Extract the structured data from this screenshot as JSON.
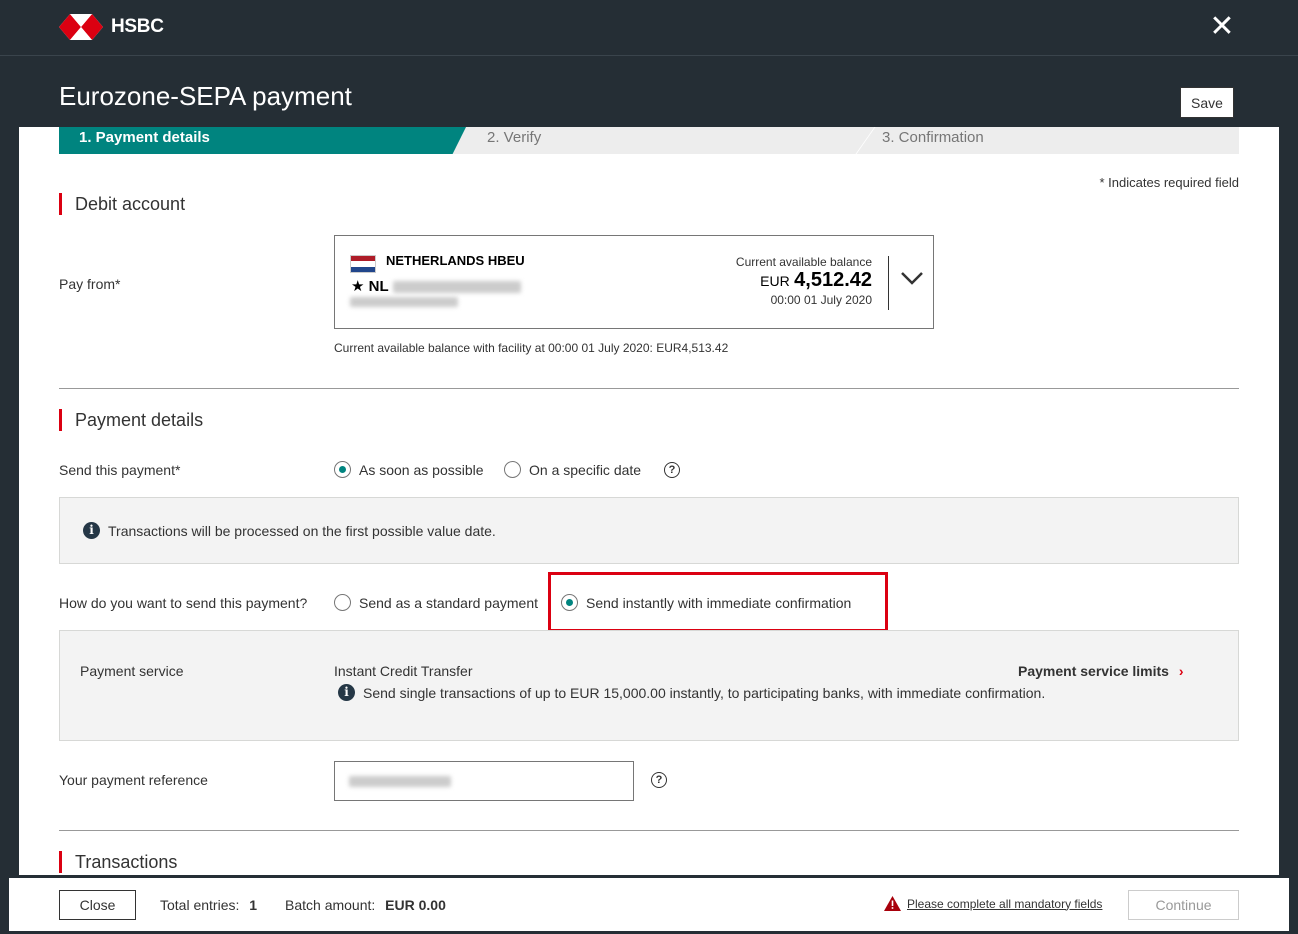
{
  "header": {
    "brand": "HSBC",
    "title": "Eurozone-SEPA payment",
    "save_label": "Save",
    "close_icon": "close-icon"
  },
  "stepper": {
    "steps": [
      {
        "label": "1. Payment details",
        "state": "active"
      },
      {
        "label": "2. Verify",
        "state": "pending"
      },
      {
        "label": "3. Confirmation",
        "state": "pending"
      }
    ]
  },
  "required_note": "* Indicates required field",
  "debit": {
    "heading": "Debit account",
    "pay_from_label": "Pay from*",
    "account": {
      "name": "NETHERLANDS HBEU",
      "prefix": "NL",
      "balance_label": "Current available balance",
      "currency": "EUR",
      "amount": "4,512.42",
      "date": "00:00 01 July 2020"
    },
    "facility_note": "Current available balance with facility at 00:00 01 July 2020: EUR4,513.42"
  },
  "payment": {
    "heading": "Payment details",
    "send_label": "Send this payment*",
    "send_options": [
      {
        "label": "As soon as possible",
        "checked": true
      },
      {
        "label": "On a specific date",
        "checked": false
      }
    ],
    "info_text": "Transactions will be processed on the first possible value date.",
    "method_label": "How do you want to send this payment?",
    "method_options": [
      {
        "label": "Send as a standard payment",
        "checked": false
      },
      {
        "label": "Send instantly with immediate confirmation",
        "checked": true
      }
    ],
    "service_label": "Payment service",
    "service_value": "Instant Credit Transfer",
    "service_limits_link": "Payment service limits",
    "service_info": "Send single transactions of up to EUR 15,000.00 instantly, to participating banks, with immediate confirmation.",
    "reference_label": "Your payment reference"
  },
  "transactions": {
    "heading": "Transactions"
  },
  "footer": {
    "close_label": "Close",
    "total_label": "Total entries:",
    "total_value": "1",
    "batch_label": "Batch amount:",
    "batch_value": "EUR 0.00",
    "warning_text": "Please complete all mandatory fields",
    "continue_label": "Continue"
  },
  "colors": {
    "brand_red": "#db0011",
    "accent_teal": "#00847f",
    "header_bg": "#252e35"
  }
}
